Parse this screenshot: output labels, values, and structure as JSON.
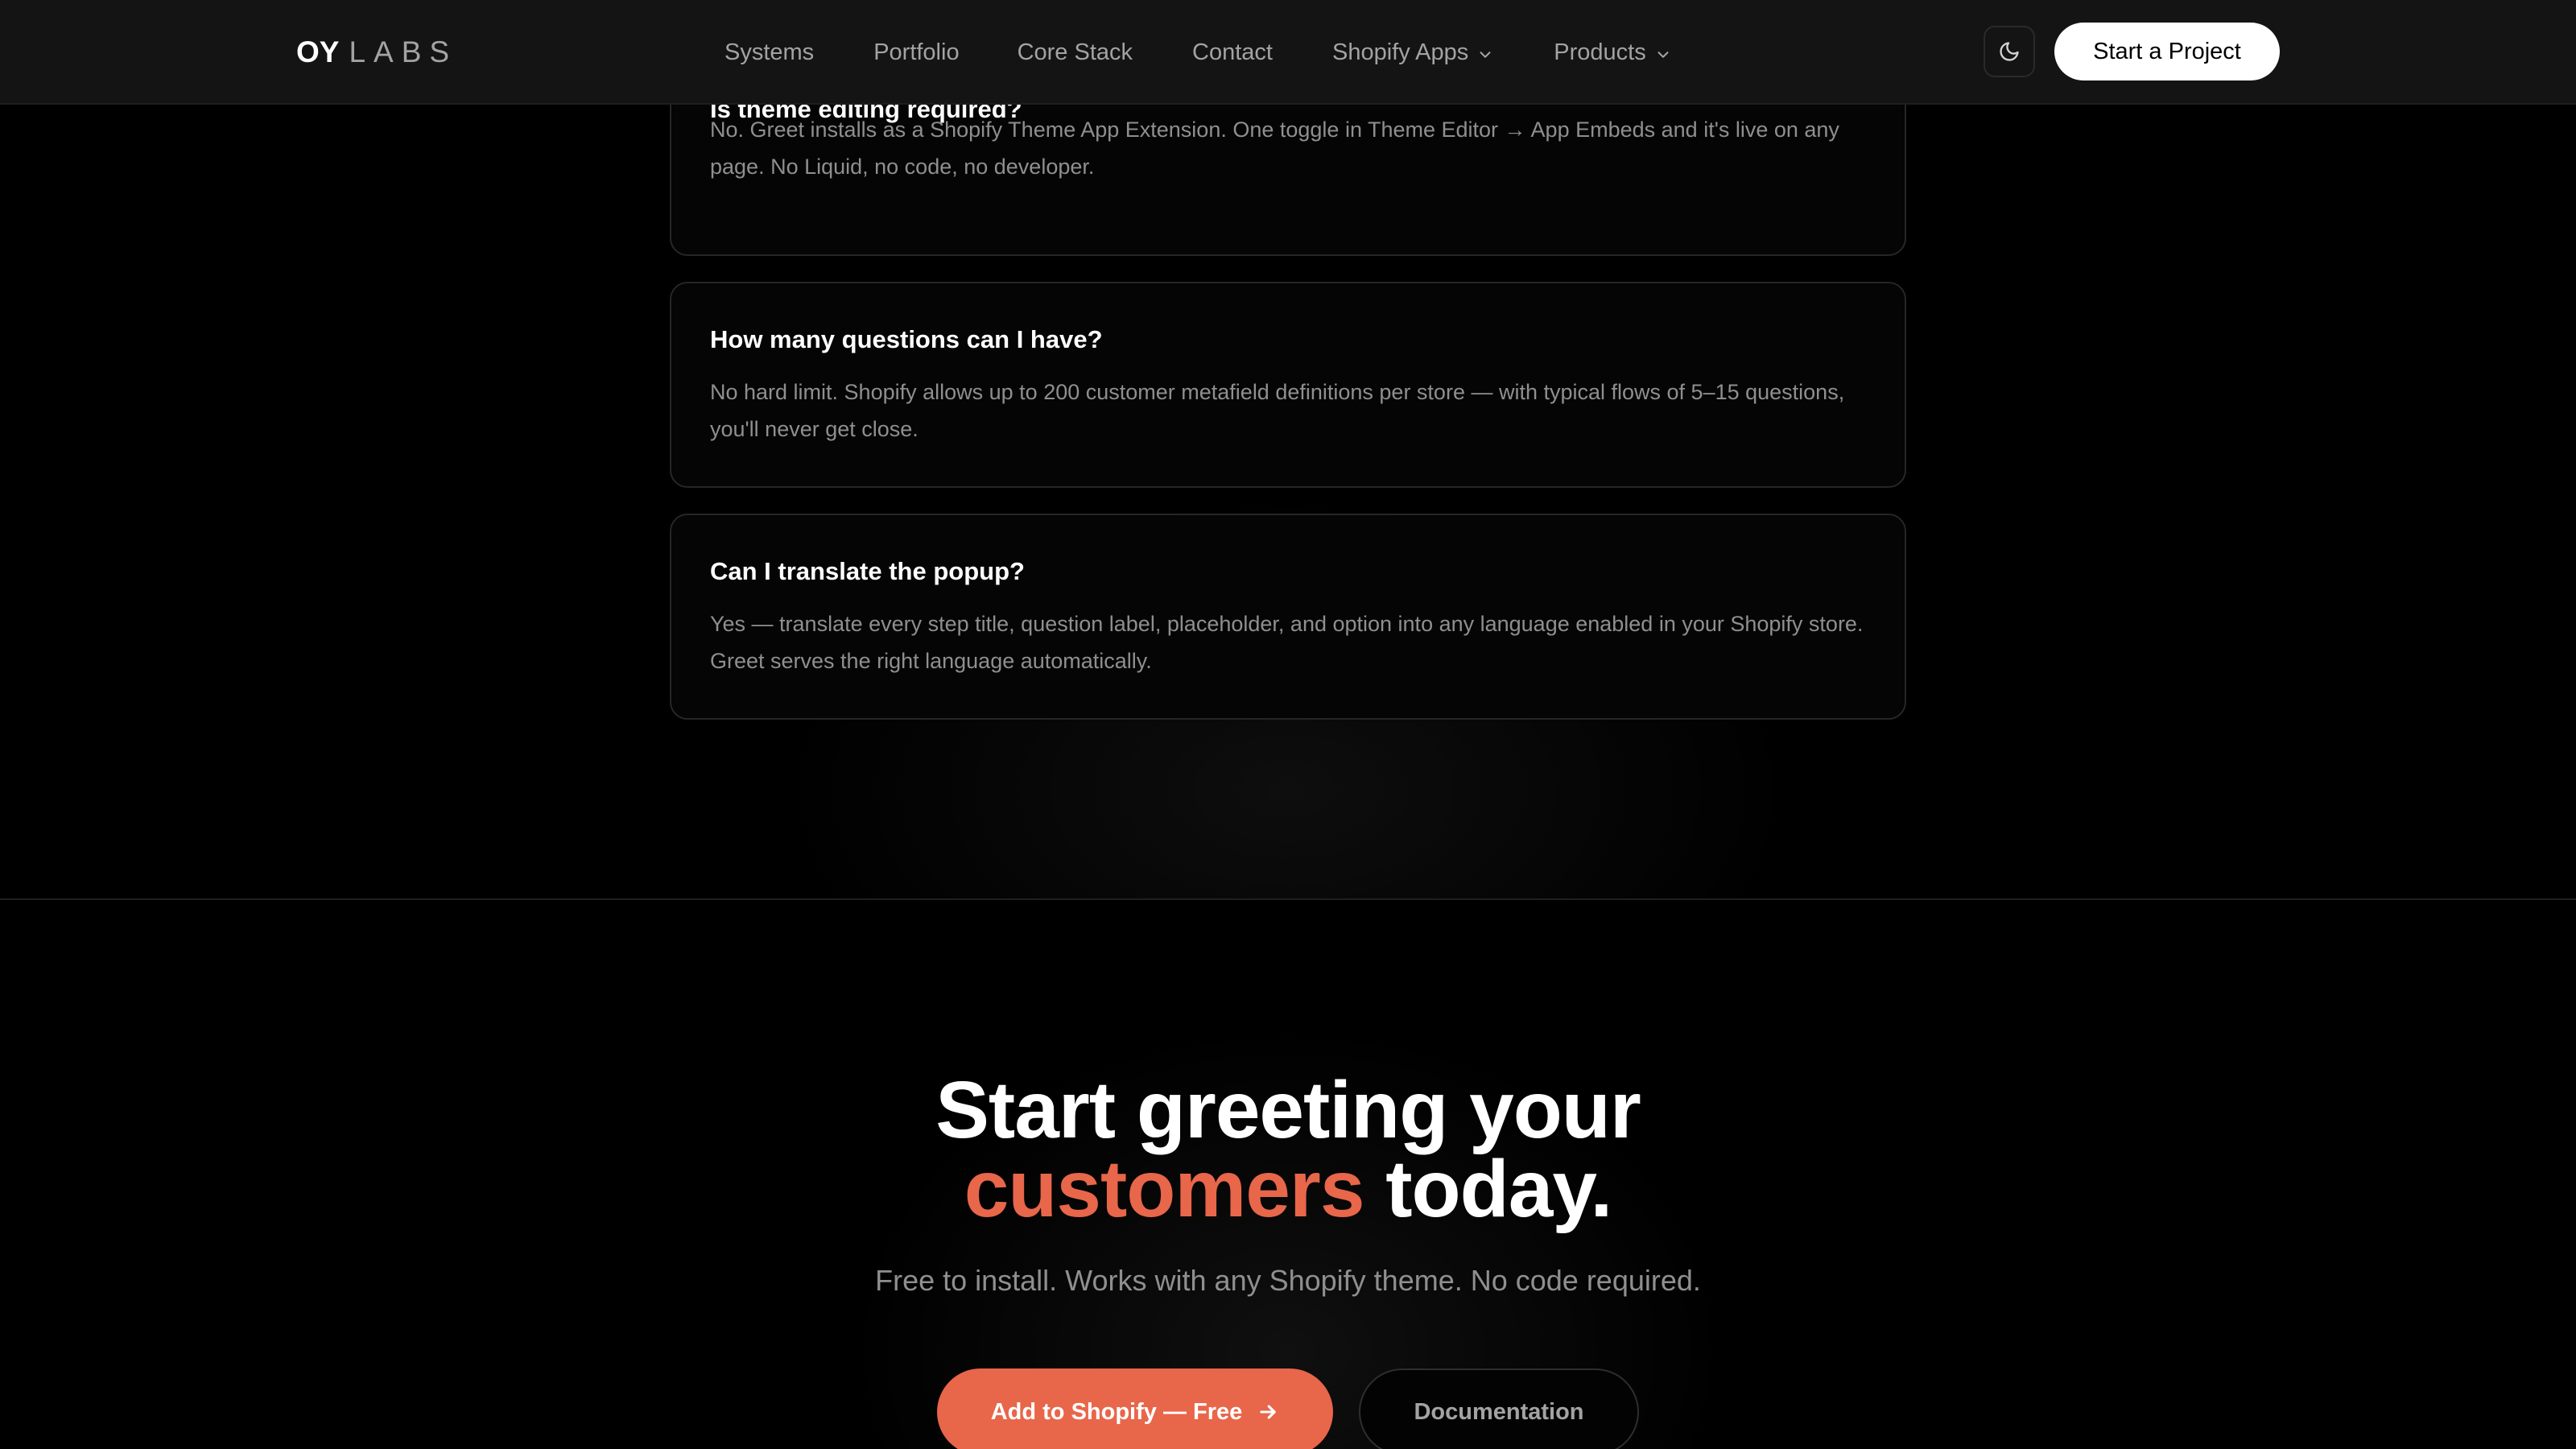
{
  "nav": {
    "logo_bold": "OY",
    "logo_light": "LABS",
    "links": [
      "Systems",
      "Portfolio",
      "Core Stack",
      "Contact",
      "Shopify Apps",
      "Products"
    ],
    "theme_icon": "moon-icon",
    "cta_label": "Start a Project"
  },
  "faq": [
    {
      "question": "Is theme editing required?",
      "answer": "No. Greet installs as a Shopify Theme App Extension. One toggle in Theme Editor → App Embeds and it's live on any page. No Liquid, no code, no developer."
    },
    {
      "question": "How many questions can I have?",
      "answer": "No hard limit. Shopify allows up to 200 customer metafield definitions per store — with typical flows of 5–15 questions, you'll never get close."
    },
    {
      "question": "Can I translate the popup?",
      "answer": "Yes — translate every step title, question label, placeholder, and option into any language enabled in your Shopify store. Greet serves the right language automatically."
    }
  ],
  "cta": {
    "title_line1": "Start greeting your",
    "title_accent": "customers",
    "title_rest": " today.",
    "subtitle": "Free to install. Works with any Shopify theme. No code required.",
    "primary_label": "Add to Shopify — Free",
    "secondary_label": "Documentation"
  },
  "colors": {
    "accent": "#e8664a",
    "background": "#000000",
    "nav_background": "#141414",
    "muted_text": "#8f8f8f"
  }
}
